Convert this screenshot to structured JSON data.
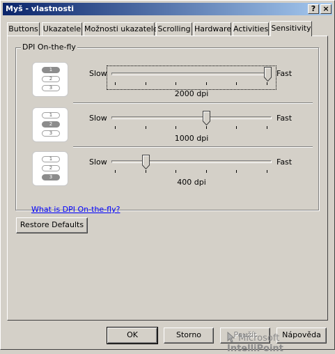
{
  "window": {
    "title": "Myš - vlastnosti",
    "help_glyph": "?",
    "close_glyph": "×"
  },
  "tabs": [
    {
      "label": "Buttons"
    },
    {
      "label": "Ukazatele"
    },
    {
      "label": "Možnosti ukazatele"
    },
    {
      "label": "Scrolling"
    },
    {
      "label": "Hardware"
    },
    {
      "label": "Activities"
    },
    {
      "label": "Sensitivity",
      "active": true
    }
  ],
  "dpi": {
    "legend": "DPI On-the-fly",
    "rows": [
      {
        "pills": [
          "1",
          "2",
          "3"
        ],
        "selected": "1",
        "slow": "Slow",
        "fast": "Fast",
        "value": "2000 dpi",
        "level": 1.0
      },
      {
        "pills": [
          "1",
          "2",
          "3"
        ],
        "selected": "2",
        "slow": "Slow",
        "fast": "Fast",
        "value": "1000 dpi",
        "level": 0.6
      },
      {
        "pills": [
          "1",
          "2",
          "3"
        ],
        "selected": "3",
        "slow": "Slow",
        "fast": "Fast",
        "value": "400 dpi",
        "level": 0.2
      }
    ],
    "help_link": "What is DPI On-the-fly?"
  },
  "restore_defaults": "Restore Defaults",
  "brand": {
    "name": "Microsoft",
    "product": "IntelliPoint"
  },
  "buttons": {
    "ok": "OK",
    "cancel": "Storno",
    "apply": "Použít",
    "help": "Nápověda"
  }
}
